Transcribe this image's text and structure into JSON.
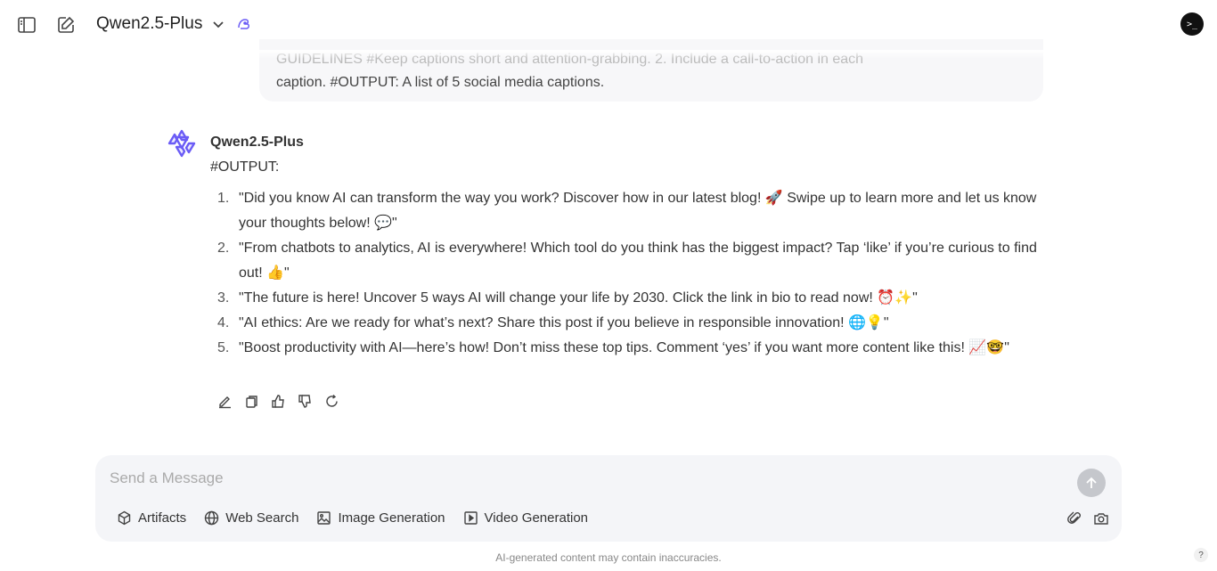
{
  "header": {
    "model_name": "Qwen2.5-Plus",
    "avatar_text": ">_"
  },
  "user_message": {
    "line1": "GUIDELINES  #Keep captions short and attention-grabbing.  2. Include a call-to-action in each",
    "line2": "caption.  #OUTPUT:  A list of 5 social media captions."
  },
  "assistant": {
    "name": "Qwen2.5-Plus",
    "heading": "#OUTPUT:",
    "items": [
      {
        "num": "1.",
        "text": "\"Did you know AI can transform the way you work? Discover how in our latest blog! 🚀 Swipe up to learn more and let us know your thoughts below! 💬\""
      },
      {
        "num": "2.",
        "text": "\"From chatbots to analytics, AI is everywhere! Which tool do you think has the biggest impact? Tap ‘like’ if you’re curious to find out! 👍\""
      },
      {
        "num": "3.",
        "text": "\"The future is here! Uncover 5 ways AI will change your life by 2030. Click the link in bio to read now! ⏰✨\""
      },
      {
        "num": "4.",
        "text": "\"AI ethics: Are we ready for what’s next? Share this post if you believe in responsible innovation! 🌐💡\""
      },
      {
        "num": "5.",
        "text": "\"Boost productivity with AI—here’s how! Don’t miss these top tips. Comment ‘yes’ if you want more content like this! 📈🤓\""
      }
    ]
  },
  "composer": {
    "placeholder": "Send a Message",
    "tools": {
      "artifacts": "Artifacts",
      "web_search": "Web Search",
      "image_generation": "Image Generation",
      "video_generation": "Video Generation"
    }
  },
  "footer": {
    "disclaimer": "AI-generated content may contain inaccuracies.",
    "help": "?"
  },
  "colors": {
    "accent_purple": "#6b5cf6",
    "send_button": "#c5c7cc",
    "composer_bg": "#f4f5f8"
  }
}
